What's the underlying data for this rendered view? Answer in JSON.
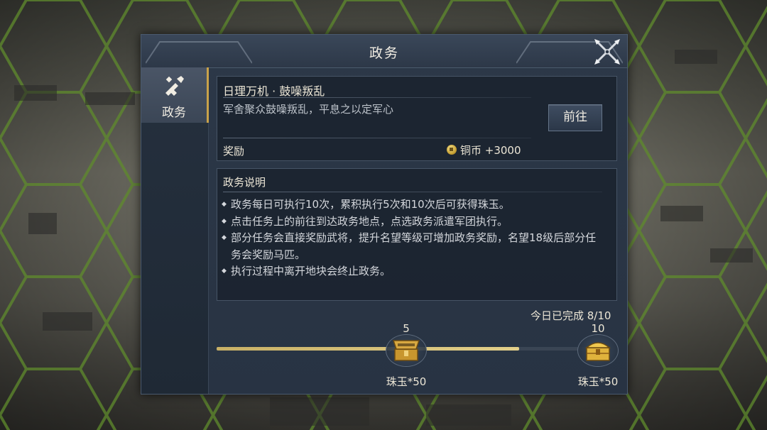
{
  "dialog": {
    "title": "政务",
    "close_icon": "crossed-blades-close-icon"
  },
  "sidebar": {
    "tabs": [
      {
        "label": "政务",
        "icon": "brush-scroll-icon",
        "active": true
      }
    ]
  },
  "task": {
    "title": "日理万机 · 鼓噪叛乱",
    "description": "军舍聚众鼓噪叛乱，平息之以定军心",
    "goto_label": "前往",
    "reward_label": "奖励",
    "reward_icon": "copper-coin-icon",
    "reward_text": "铜币 +3000"
  },
  "info": {
    "heading": "政务说明",
    "items": [
      "政务每日可执行10次，累积执行5次和10次后可获得珠玉。",
      "点击任务上的前往到达政务地点，点选政务派遣军团执行。",
      "部分任务会直接奖励武将，提升名望等级可增加政务奖励，名望18级后部分任务会奖励马匹。",
      "执行过程中离开地块会终止政务。"
    ]
  },
  "progress": {
    "label": "今日已完成 8/10",
    "completed": 8,
    "total": 10,
    "fill_color": "#d8c27a",
    "milestones": [
      {
        "count": "5",
        "reward": "珠玉*50",
        "icon": "open-treasure-chest-icon"
      },
      {
        "count": "10",
        "reward": "珠玉*50",
        "icon": "gold-treasure-chest-icon"
      }
    ]
  },
  "colors": {
    "panel": "#2a3545",
    "accent_gold": "#c9a24a",
    "text": "#ece6d6"
  }
}
